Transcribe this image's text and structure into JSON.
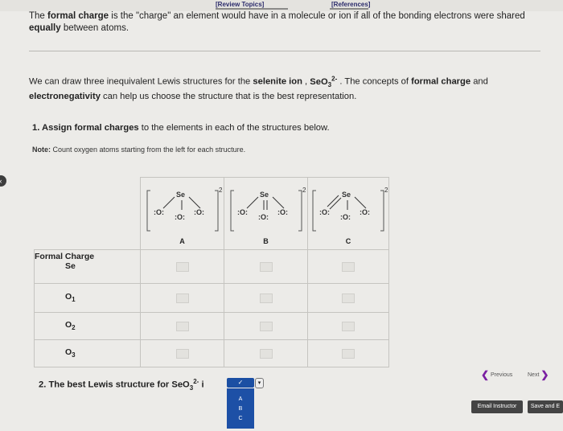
{
  "topbar": {
    "review_topics": "[Review Topics]",
    "references": "[References]"
  },
  "intro": {
    "pre": "The ",
    "b1": "formal charge",
    "mid": " is the \"charge\" an element would have in a molecule or ion if all of the bonding electrons were shared ",
    "b2": "equally",
    "post": " between atoms."
  },
  "para2": {
    "pre": "We can draw three inequivalent Lewis structures for the ",
    "b1": "selenite ion",
    "mid1": " , ",
    "formula_base": "SeO",
    "formula_sub": "3",
    "formula_sup": "2-",
    "mid2": " . The concepts of ",
    "b2": "formal charge",
    "mid3": " and ",
    "b3": "electronegativity",
    "post": " can help us choose the structure that is the best representation."
  },
  "q1": {
    "num": "1. ",
    "b": "Assign formal charges",
    "rest": " to the elements in each of the structures below."
  },
  "note": {
    "label": "Note:",
    "text": " Count oxygen atoms starting from the left for each structure."
  },
  "structures": [
    {
      "label": "A",
      "charge": "2-",
      "se": "Se",
      "o": ":O:"
    },
    {
      "label": "B",
      "charge": "2-",
      "se": "Se",
      "o": ":O:"
    },
    {
      "label": "C",
      "charge": "2-",
      "se": "Se",
      "o": ":O:"
    }
  ],
  "rows": {
    "fc_title": "Formal Charge",
    "se": "Se",
    "o1_base": "O",
    "o1_sub": "1",
    "o2_base": "O",
    "o2_sub": "2",
    "o3_base": "O",
    "o3_sub": "3"
  },
  "q2": {
    "text": "2. The best Lewis structure for SeO",
    "sub": "3",
    "sup": "2-",
    "tail": " i"
  },
  "dropdown": {
    "selected": "✓",
    "options": [
      "A",
      "B",
      "C"
    ]
  },
  "nav": {
    "previous": "Previous",
    "next": "Next"
  },
  "buttons": {
    "email": "Email Instructor",
    "save": "Save and E"
  },
  "colors": {
    "accent": "#1d50a6",
    "nav_chevron": "#7a1fa2",
    "button": "#444444"
  }
}
